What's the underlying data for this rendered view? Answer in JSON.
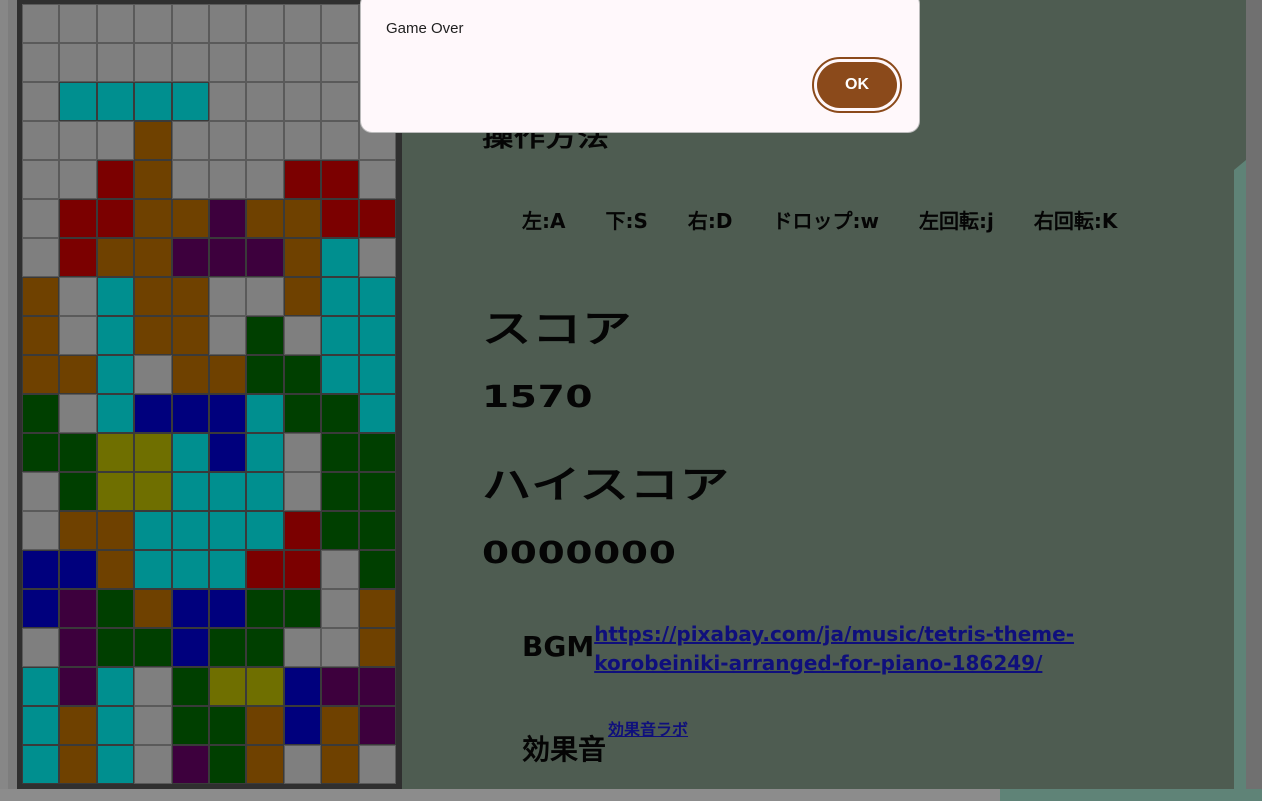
{
  "dialog": {
    "title": "",
    "message": "Game Over",
    "ok_label": "OK"
  },
  "info": {
    "controls_title": "操作方法",
    "controls": [
      "左:A",
      "下:S",
      "右:D",
      "ドロップ:w",
      "左回転:j",
      "右回転:K"
    ],
    "score_title": "スコア",
    "score_value": "1570",
    "high_score_title": "ハイスコア",
    "high_score_value": "0000000",
    "bgm_label": "BGM",
    "bgm_link": "https://pixabay.com/ja/music/tetris-theme-korobeiniki-arranged-for-piano-186249/",
    "se_label": "効果音",
    "se_link": "効果音ラボ"
  },
  "colors": {
    "O": "#6f6f00",
    "I": "#008f8f",
    "T": "#3d003d",
    "S": "#003f00",
    "Z": "#7b0000",
    "J": "#00007d",
    "L": "#6f4100",
    "empty": "#7f7f7f",
    "board_bg": "#2f2f2f",
    "panel": "#4e5c51",
    "accent": "#8b4a1b"
  },
  "board": [
    "..........",
    "..........",
    ".IIII.....",
    "...L......",
    "..ZL...ZZ.",
    ".ZZLLTLLZZ",
    ".ZLLTTTLI.",
    "L.ILL..LII",
    "L.ILL.S.II",
    "LLI.LLSSII",
    "S.IJJJISSI",
    "SSOOIJI.SS",
    ".SOOIII.SS",
    ".LLIIIIZSS",
    "JJLIIIZZ.S",
    "JTSLJJSS.L",
    ".TSSJSS..L",
    "ITI.SOOJTT",
    "ILI.SSLJLT",
    "ILI.TSL.L."
  ]
}
